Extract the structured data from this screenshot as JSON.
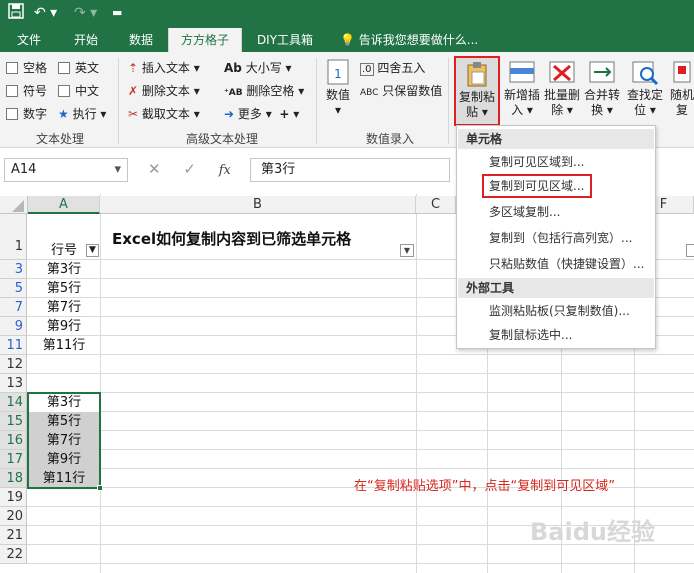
{
  "tabs": [
    "文件",
    "开始",
    "数据",
    "方方格子",
    "DIY工具箱"
  ],
  "tell_me": "告诉我您想要做什么...",
  "ribbon": {
    "text_group": {
      "label": "文本处理",
      "checks": [
        "空格",
        "英文",
        "符号",
        "中文",
        "数字"
      ],
      "execute": "执行"
    },
    "adv_group": {
      "label": "高级文本处理",
      "items": [
        "插入文本",
        "删除文本",
        "截取文本",
        "大小写",
        "删除空格",
        "更多"
      ]
    },
    "value_group": {
      "label": "数值录入",
      "value_btn": [
        "数值",
        "▾"
      ],
      "items": [
        "四舍五入",
        "只保留数值"
      ]
    },
    "big_buttons": [
      {
        "l1": "复制粘",
        "l2": "贴 ▾"
      },
      {
        "l1": "新增插",
        "l2": "入 ▾"
      },
      {
        "l1": "批量删",
        "l2": "除 ▾"
      },
      {
        "l1": "合并转",
        "l2": "换 ▾"
      },
      {
        "l1": "查找定",
        "l2": "位 ▾"
      },
      {
        "l1": "随机",
        "l2": "复"
      }
    ]
  },
  "formula_bar": {
    "name_box": "A14",
    "fx": "fx",
    "value": "第3行"
  },
  "columns": [
    "A",
    "B",
    "C",
    "F"
  ],
  "title": "Excel如何复制内容到已筛选单元格",
  "rows": [
    {
      "num": "1",
      "a": "行号"
    },
    {
      "num": "3",
      "a": "第3行"
    },
    {
      "num": "5",
      "a": "第5行"
    },
    {
      "num": "7",
      "a": "第7行"
    },
    {
      "num": "9",
      "a": "第9行"
    },
    {
      "num": "11",
      "a": "第11行"
    },
    {
      "num": "12",
      "a": ""
    },
    {
      "num": "13",
      "a": ""
    },
    {
      "num": "14",
      "a": "第3行"
    },
    {
      "num": "15",
      "a": "第5行"
    },
    {
      "num": "16",
      "a": "第7行"
    },
    {
      "num": "17",
      "a": "第9行"
    },
    {
      "num": "18",
      "a": "第11行"
    },
    {
      "num": "19",
      "a": ""
    },
    {
      "num": "20",
      "a": ""
    },
    {
      "num": "21",
      "a": ""
    },
    {
      "num": "22",
      "a": ""
    }
  ],
  "annotation": "在“复制粘贴选项”中，点击“复制到可见区域”",
  "dropdown": {
    "header1": "单元格",
    "items1": [
      "复制可见区域到...",
      "复制到可见区域...",
      "多区域复制...",
      "复制到（包括行高列宽）...",
      "只粘贴数值（快捷键设置）..."
    ],
    "header2": "外部工具",
    "items2": [
      "监测粘贴板(只复制数值)...",
      "复制鼠标选中..."
    ]
  },
  "watermark": "Baidu经验",
  "colors": {
    "excel_green": "#217346",
    "highlight_red": "#e02020",
    "annotation_red": "#d9261c"
  }
}
